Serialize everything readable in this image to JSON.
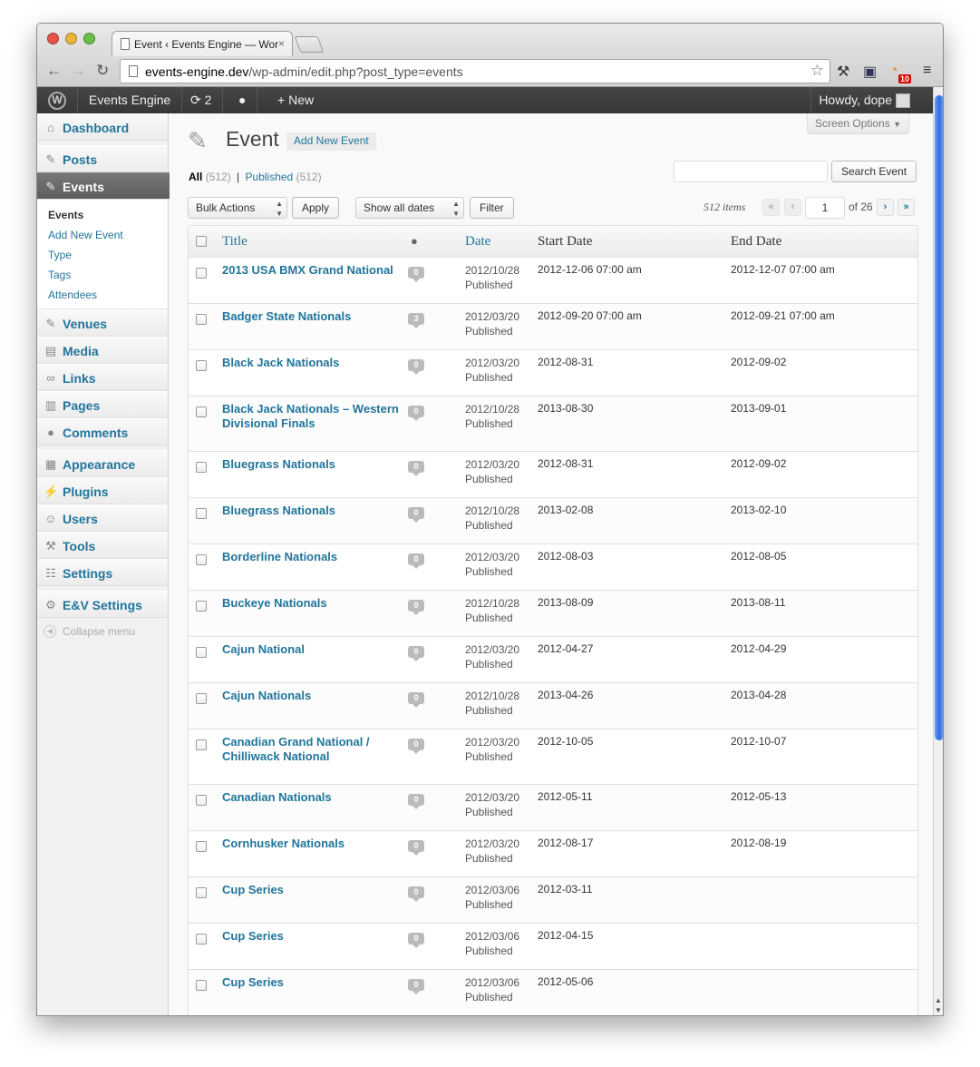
{
  "browser": {
    "tab_title": "Event ‹ Events Engine — Wor",
    "tab_close": "×",
    "url_domain": "events-engine.dev",
    "url_path": "/wp-admin/edit.php?post_type=events",
    "rss_badge": "10"
  },
  "adminbar": {
    "site_name": "Events Engine",
    "updates_count": "2",
    "new_label": "New",
    "howdy": "Howdy, dope"
  },
  "sidebar": {
    "dashboard": "Dashboard",
    "posts": "Posts",
    "events": "Events",
    "submenu": [
      "Events",
      "Add New Event",
      "Type",
      "Tags",
      "Attendees"
    ],
    "venues": "Venues",
    "media": "Media",
    "links": "Links",
    "pages": "Pages",
    "comments": "Comments",
    "appearance": "Appearance",
    "plugins": "Plugins",
    "users": "Users",
    "tools": "Tools",
    "settings": "Settings",
    "ev_settings": "E&V Settings",
    "collapse": "Collapse menu"
  },
  "main": {
    "screen_options": "Screen Options",
    "page_title": "Event",
    "add_new": "Add New Event",
    "filter_all": "All",
    "filter_all_count": "(512)",
    "filter_sep": "|",
    "filter_published": "Published",
    "filter_published_count": "(512)",
    "search_button": "Search Event",
    "bulk_actions": "Bulk Actions",
    "apply": "Apply",
    "show_dates": "Show all dates",
    "filter_button": "Filter",
    "items_count": "512 items",
    "page_current": "1",
    "page_of": "of 26",
    "pager": {
      "first": "«",
      "prev": "‹",
      "next": "›",
      "last": "»"
    }
  },
  "table": {
    "headers": {
      "title": "Title",
      "date": "Date",
      "start": "Start Date",
      "end": "End Date"
    },
    "rows": [
      {
        "title": "2013 USA BMX Grand National",
        "comments": "0",
        "date": "2012/10/28",
        "status": "Published",
        "start": "2012-12-06 07:00 am",
        "end": "2012-12-07 07:00 am"
      },
      {
        "title": "Badger State Nationals",
        "comments": "3",
        "date": "2012/03/20",
        "status": "Published",
        "start": "2012-09-20 07:00 am",
        "end": "2012-09-21 07:00 am"
      },
      {
        "title": "Black Jack Nationals",
        "comments": "0",
        "date": "2012/03/20",
        "status": "Published",
        "start": "2012-08-31",
        "end": "2012-09-02"
      },
      {
        "title": "Black Jack Nationals – Western Divisional Finals",
        "comments": "0",
        "date": "2012/10/28",
        "status": "Published",
        "start": "2013-08-30",
        "end": "2013-09-01"
      },
      {
        "title": "Bluegrass Nationals",
        "comments": "0",
        "date": "2012/03/20",
        "status": "Published",
        "start": "2012-08-31",
        "end": "2012-09-02"
      },
      {
        "title": "Bluegrass Nationals",
        "comments": "0",
        "date": "2012/10/28",
        "status": "Published",
        "start": "2013-02-08",
        "end": "2013-02-10"
      },
      {
        "title": "Borderline Nationals",
        "comments": "0",
        "date": "2012/03/20",
        "status": "Published",
        "start": "2012-08-03",
        "end": "2012-08-05"
      },
      {
        "title": "Buckeye Nationals",
        "comments": "0",
        "date": "2012/10/28",
        "status": "Published",
        "start": "2013-08-09",
        "end": "2013-08-11"
      },
      {
        "title": "Cajun National",
        "comments": "0",
        "date": "2012/03/20",
        "status": "Published",
        "start": "2012-04-27",
        "end": "2012-04-29"
      },
      {
        "title": "Cajun Nationals",
        "comments": "0",
        "date": "2012/10/28",
        "status": "Published",
        "start": "2013-04-26",
        "end": "2013-04-28"
      },
      {
        "title": "Canadian Grand National / Chilliwack National",
        "comments": "0",
        "date": "2012/03/20",
        "status": "Published",
        "start": "2012-10-05",
        "end": "2012-10-07"
      },
      {
        "title": "Canadian Nationals",
        "comments": "0",
        "date": "2012/03/20",
        "status": "Published",
        "start": "2012-05-11",
        "end": "2012-05-13"
      },
      {
        "title": "Cornhusker Nationals",
        "comments": "0",
        "date": "2012/03/20",
        "status": "Published",
        "start": "2012-08-17",
        "end": "2012-08-19"
      },
      {
        "title": "Cup Series",
        "comments": "0",
        "date": "2012/03/06",
        "status": "Published",
        "start": "2012-03-11",
        "end": ""
      },
      {
        "title": "Cup Series",
        "comments": "0",
        "date": "2012/03/06",
        "status": "Published",
        "start": "2012-04-15",
        "end": ""
      },
      {
        "title": "Cup Series",
        "comments": "0",
        "date": "2012/03/06",
        "status": "Published",
        "start": "2012-05-06",
        "end": ""
      }
    ]
  }
}
